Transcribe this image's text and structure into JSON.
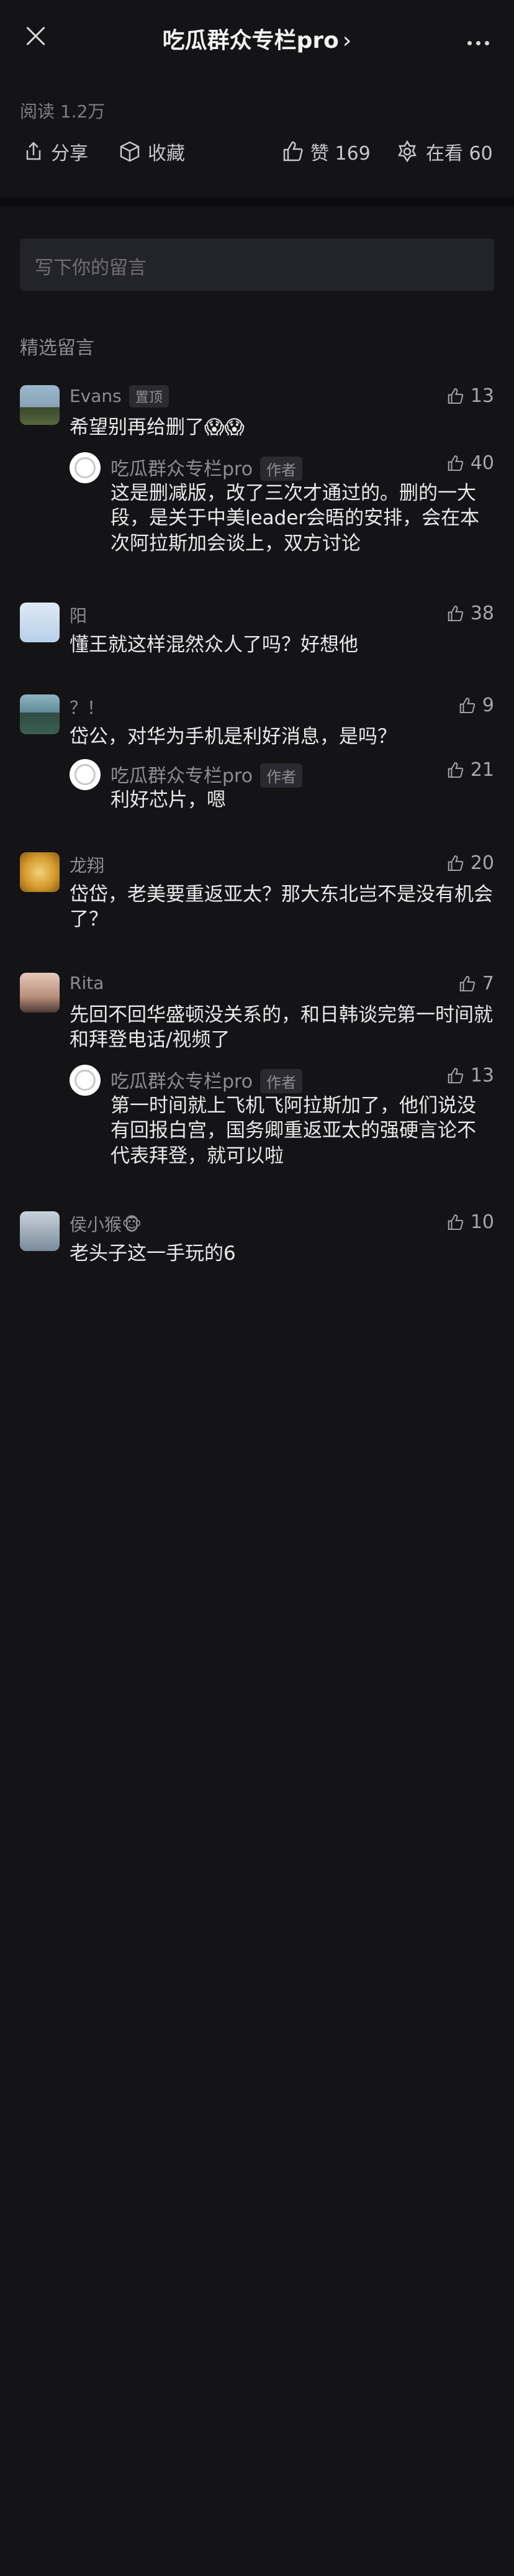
{
  "header": {
    "title": "吃瓜群众专栏pro",
    "title_chevron": "›",
    "read_count": "阅读 1.2万"
  },
  "actions": {
    "share": "分享",
    "collect": "收藏",
    "like": "赞 169",
    "watching": "在看 60"
  },
  "input": {
    "placeholder": "写下你的留言"
  },
  "section_title": "精选留言",
  "comments": [
    {
      "name": "Evans",
      "badge": "置顶",
      "likes": "13",
      "text": "希望别再给删了😱😱",
      "reply": {
        "name": "吃瓜群众专栏pro",
        "badge": "作者",
        "likes": "40",
        "text": "这是删减版，改了三次才通过的。删的一大段，是关于中美leader会晤的安排，会在本次阿拉斯加会谈上，双方讨论"
      }
    },
    {
      "name": "阳",
      "likes": "38",
      "text": "懂王就这样混然众人了吗？好想他"
    },
    {
      "name": "？！",
      "likes": "9",
      "text": "岱公，对华为手机是利好消息，是吗？",
      "reply": {
        "name": "吃瓜群众专栏pro",
        "badge": "作者",
        "likes": "21",
        "text": "利好芯片，嗯"
      }
    },
    {
      "name": "龙翔",
      "likes": "20",
      "text": "岱岱，老美要重返亚太？那大东北岂不是没有机会了？"
    },
    {
      "name": "Rita",
      "likes": "7",
      "text": "先回不回华盛顿没关系的，和日韩谈完第一时间就和拜登电话/视频了",
      "reply": {
        "name": "吃瓜群众专栏pro",
        "badge": "作者",
        "likes": "13",
        "text": "第一时间就上飞机飞阿拉斯加了，他们说没有回报白宫，国务卿重返亚太的强硬言论不代表拜登，就可以啦"
      }
    },
    {
      "name": "侯小猴🐵",
      "likes": "10",
      "text": "老头子这一手玩的6"
    }
  ]
}
